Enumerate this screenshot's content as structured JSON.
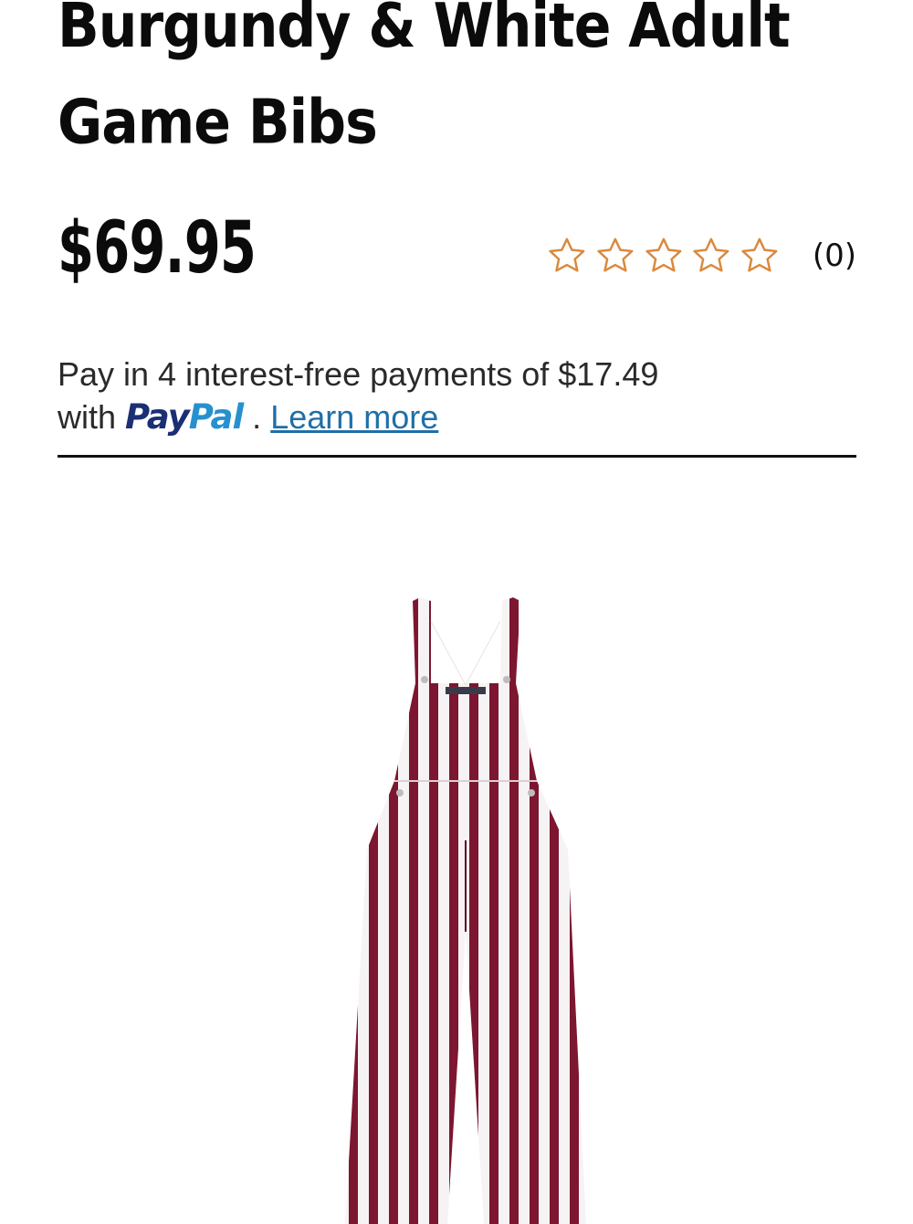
{
  "product": {
    "title": "Burgundy & White Adult Game Bibs",
    "price": "$69.95",
    "rating_stars": 0,
    "rating_max": 5,
    "review_count": "(0)",
    "image_icon": "striped-overalls-image"
  },
  "paypal": {
    "line1": "Pay in 4 interest-free payments of $17.49",
    "with": "with",
    "logo_pay": "Pay",
    "logo_pal": "Pal",
    "dot": ".",
    "learn_more": "Learn more"
  },
  "colors": {
    "star_outline": "#d98a3d",
    "burgundy": "#7d1630",
    "paypal_dark": "#1b2f75",
    "paypal_light": "#2790cf",
    "link": "#1f6fa8"
  }
}
